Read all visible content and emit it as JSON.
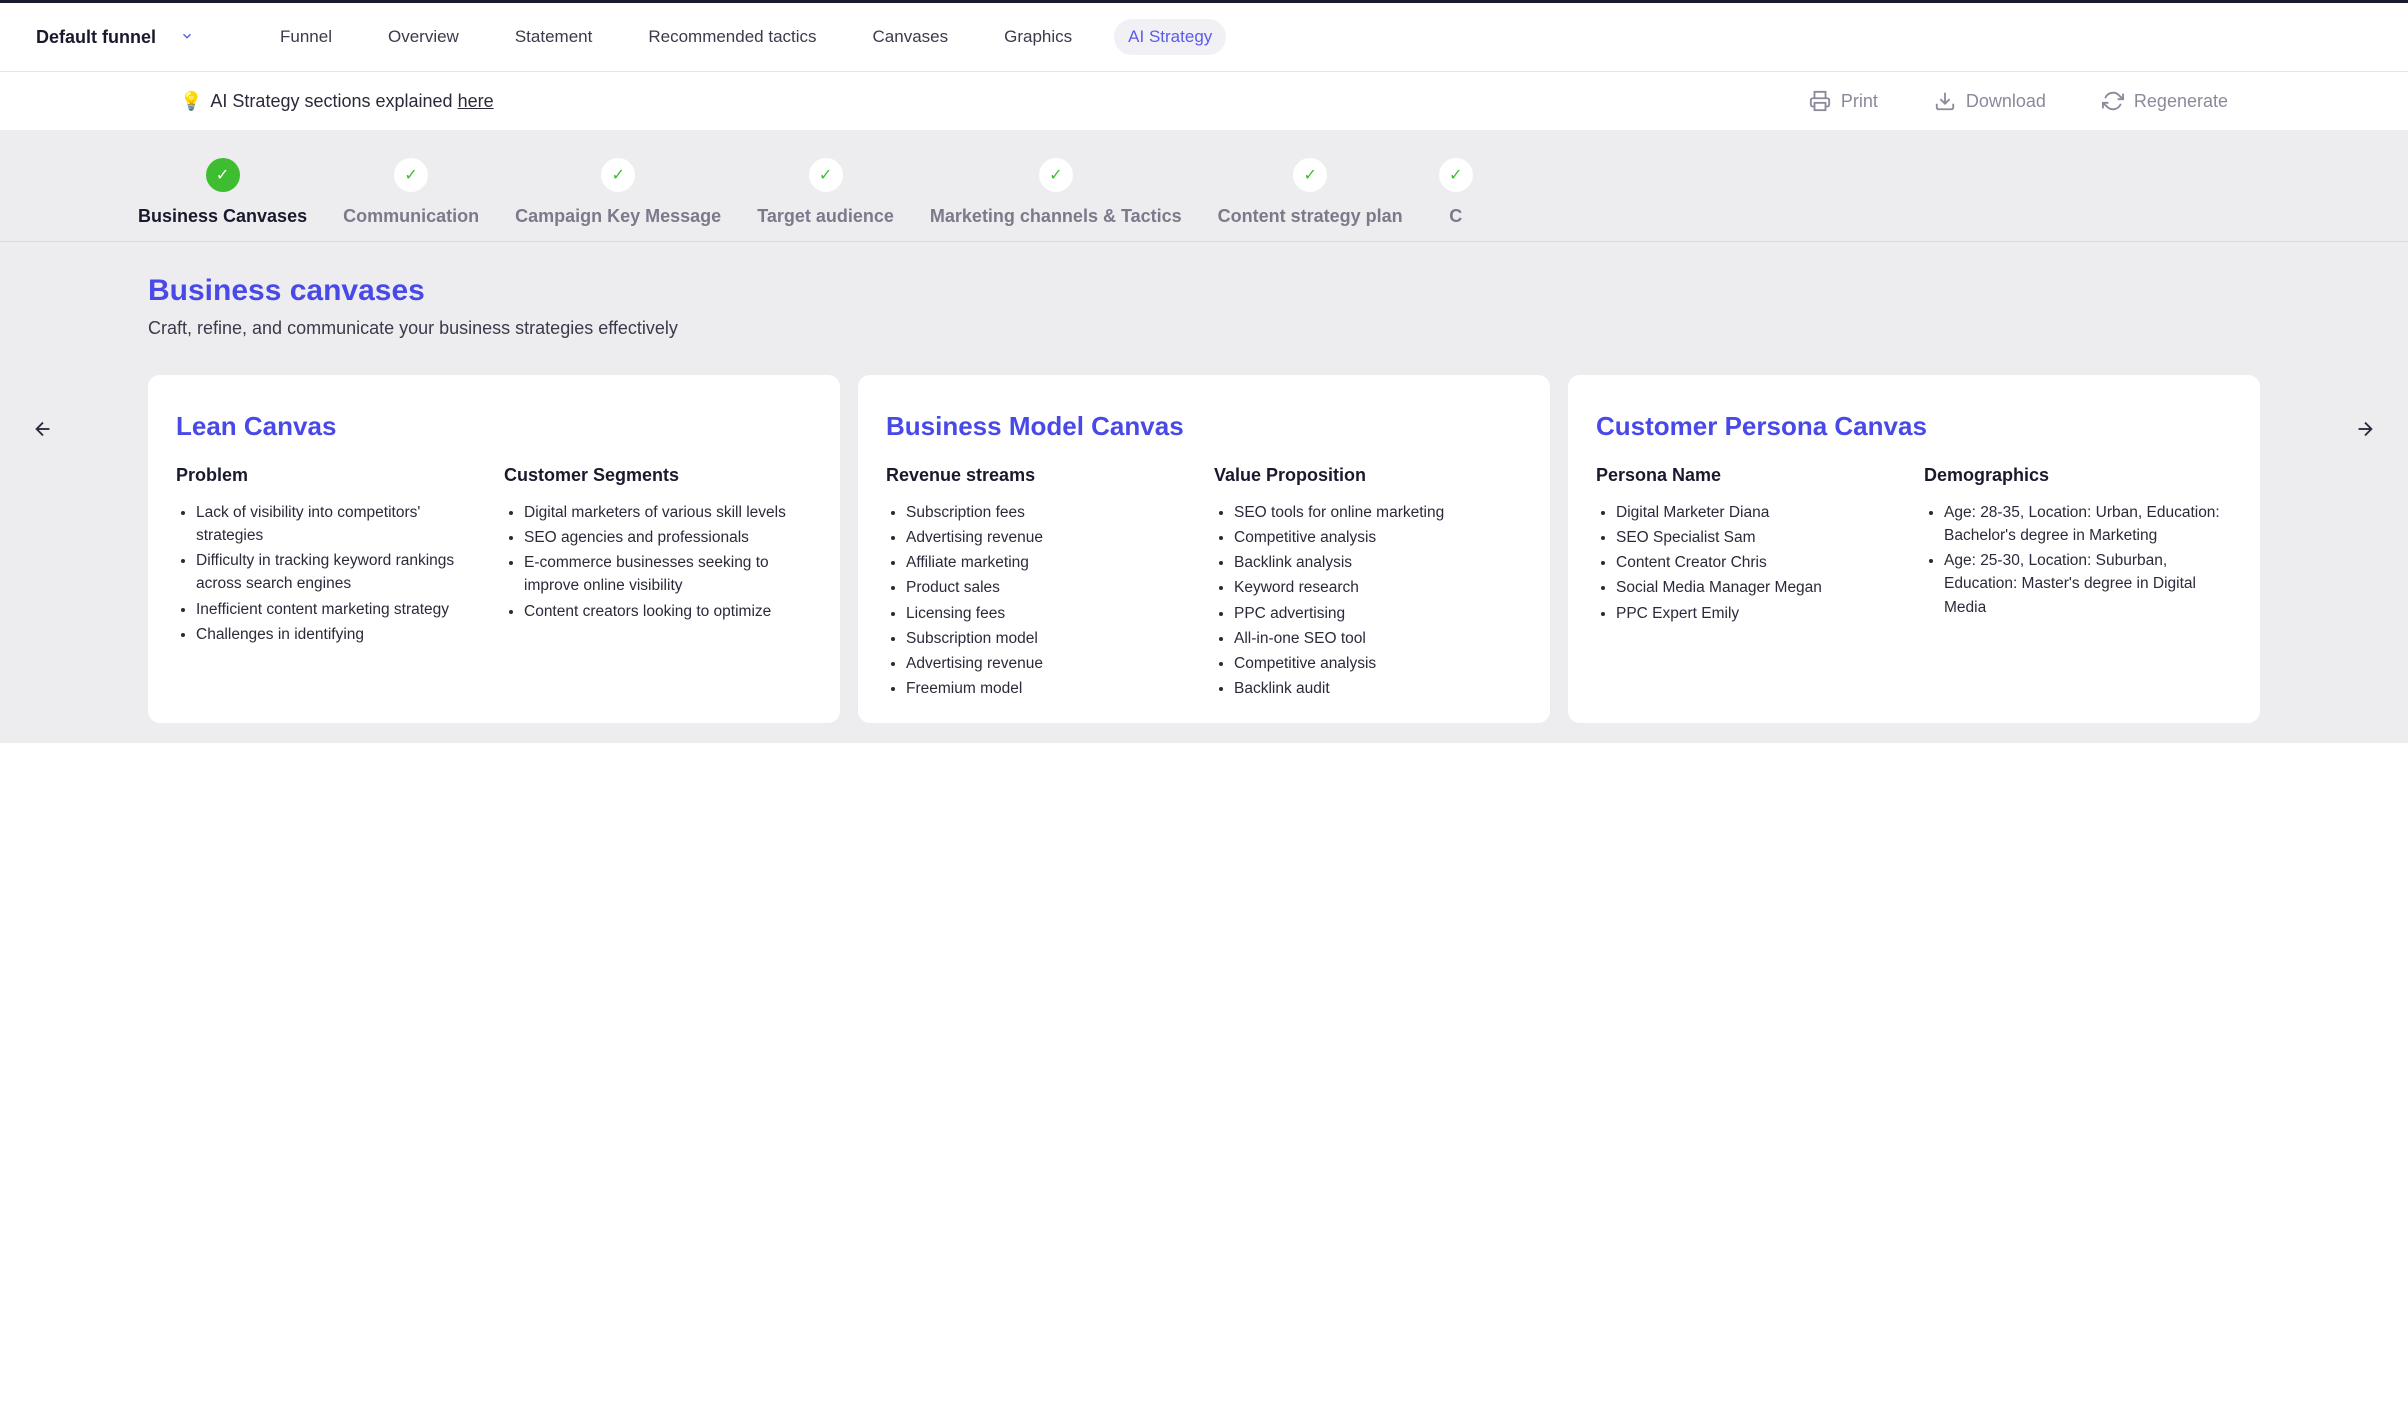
{
  "header": {
    "funnel_name": "Default funnel",
    "tabs": [
      "Funnel",
      "Overview",
      "Statement",
      "Recommended tactics",
      "Canvases",
      "Graphics",
      "AI Strategy"
    ],
    "active_tab_index": 6
  },
  "toolbar": {
    "explain_prefix": "AI Strategy sections explained ",
    "explain_link": "here",
    "print": "Print",
    "download": "Download",
    "regenerate": "Regenerate"
  },
  "steps": [
    {
      "label": "Business Canvases",
      "state": "active"
    },
    {
      "label": "Communication",
      "state": "done"
    },
    {
      "label": "Campaign Key Message",
      "state": "done"
    },
    {
      "label": "Target audience",
      "state": "done"
    },
    {
      "label": "Marketing channels & Tactics",
      "state": "done"
    },
    {
      "label": "Content strategy plan",
      "state": "done"
    },
    {
      "label": "C",
      "state": "done"
    }
  ],
  "section": {
    "title": "Business canvases",
    "subtitle": "Craft, refine, and communicate your business strategies effectively"
  },
  "cards": [
    {
      "title": "Lean Canvas",
      "cols": [
        {
          "heading": "Problem",
          "items": [
            "Lack of visibility into competitors' strategies",
            "Difficulty in tracking keyword rankings across search engines",
            "Inefficient content marketing strategy",
            "Challenges in identifying"
          ]
        },
        {
          "heading": "Customer Segments",
          "items": [
            "Digital marketers of various skill levels",
            "SEO agencies and professionals",
            "E-commerce businesses seeking to improve online visibility",
            "Content creators looking to optimize"
          ]
        }
      ]
    },
    {
      "title": "Business Model Canvas",
      "cols": [
        {
          "heading": "Revenue streams",
          "items": [
            "Subscription fees",
            "Advertising revenue",
            "Affiliate marketing",
            "Product sales",
            "Licensing fees",
            "Subscription model",
            "Advertising revenue",
            "Freemium model"
          ]
        },
        {
          "heading": "Value Proposition",
          "items": [
            "SEO tools for online marketing",
            "Competitive analysis",
            "Backlink analysis",
            "Keyword research",
            "PPC advertising",
            "All-in-one SEO tool",
            "Competitive analysis",
            "Backlink audit"
          ]
        }
      ]
    },
    {
      "title": "Customer Persona Canvas",
      "cols": [
        {
          "heading": "Persona Name",
          "items": [
            "Digital Marketer Diana",
            "SEO Specialist Sam",
            "Content Creator Chris",
            "Social Media Manager Megan",
            "PPC Expert Emily"
          ]
        },
        {
          "heading": "Demographics",
          "items": [
            "Age: 28-35, Location: Urban, Education: Bachelor's degree in Marketing",
            "Age: 25-30, Location: Suburban, Education: Master's degree in Digital Media"
          ]
        }
      ]
    }
  ]
}
